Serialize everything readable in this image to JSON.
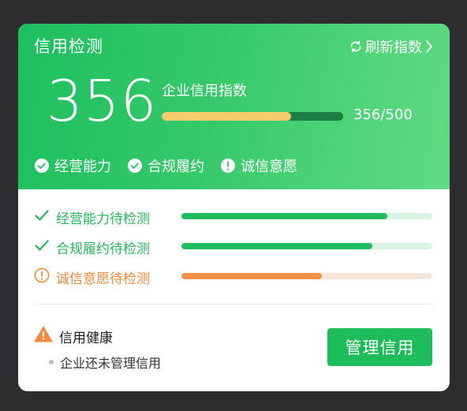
{
  "header": {
    "title": "信用检测",
    "refresh_label": "刷新指数",
    "refresh_icon": "refresh-icon",
    "chevron_icon": "chevron-right-icon"
  },
  "score": {
    "value": "356",
    "label": "企业信用指数",
    "display": "356/500",
    "current": 356,
    "max": 500
  },
  "badges": [
    {
      "label": "经营能力",
      "icon": "check-circle-icon"
    },
    {
      "label": "合规履约",
      "icon": "check-circle-icon"
    },
    {
      "label": "诚信意愿",
      "icon": "exclamation-circle-icon"
    }
  ],
  "checks": [
    {
      "label": "经营能力待检测",
      "status": "ok",
      "icon": "checkmark-icon",
      "progress": 0.82
    },
    {
      "label": "合规履约待检测",
      "status": "ok",
      "icon": "checkmark-icon",
      "progress": 0.76
    },
    {
      "label": "诚信意愿待检测",
      "status": "warn",
      "icon": "exclamation-circle-icon",
      "progress": 0.56
    }
  ],
  "health": {
    "title": "信用健康",
    "icon": "warning-triangle-icon",
    "note": "企业还未管理信用"
  },
  "action": {
    "label": "管理信用"
  },
  "colors": {
    "brand_green": "#1ebd5b",
    "warning_orange": "#f08a3e",
    "score_bar_fill": "#f3cc6e"
  }
}
